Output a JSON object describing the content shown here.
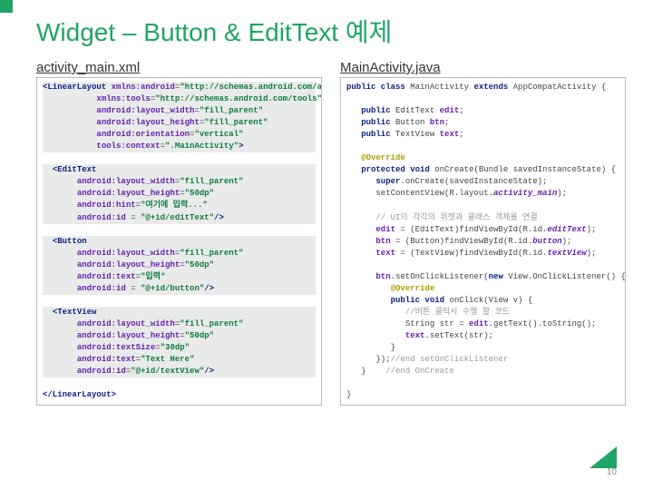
{
  "title": "Widget – Button & EditText 예제",
  "left_filename": "activity_main.xml",
  "right_filename": "MainActivity.java",
  "page_number": "10",
  "xml": {
    "root_open_tag": "<LinearLayout",
    "ns_android_attr": "xmlns:android",
    "ns_android_val": "\"http://schemas.android.com/apk/res/android\"",
    "ns_tools_attr": "xmlns:tools",
    "ns_tools_val": "\"http://schemas.android.com/tools\"",
    "lw_attr": "android:layout_width",
    "lh_attr": "android:layout_height",
    "or_attr": "android:orientation",
    "ctx_attr": "tools:context",
    "hint_attr": "android:hint",
    "id_attr": "android:id",
    "text_attr": "android:text",
    "ts_attr": "android:textSize",
    "fill_parent": "\"fill_parent\"",
    "h50": "\"50dp\"",
    "vertical": "\"vertical\"",
    "ctx": "\".MainActivity\"",
    "hint": "\"여기에 입력...\"",
    "id_edit": "\"@+id/editText\"",
    "txt_input": "\"입력\"",
    "id_btn": "\"@+id/button\"",
    "ts30": "\"30dp\"",
    "txt_here": "\"Text Here\"",
    "id_tv": "\"@+id/textView\"",
    "edittext_open": "<EditText",
    "button_open": "<Button",
    "textview_open": "<TextView",
    "close_self": "/>",
    "root_close": "</LinearLayout>",
    "gt": ">"
  },
  "java": {
    "l1a": "public class",
    "l1b": "MainActivity",
    "l1c": "extends",
    "l1d": "AppCompatActivity {",
    "l2a": "public",
    "l2b": "EditText",
    "l2c": "edit",
    "l3a": "public",
    "l3b": "Button",
    "l3c": "btn",
    "l4a": "public",
    "l4b": "TextView",
    "l4c": "text",
    "ov": "@Override",
    "l5a": "protected void",
    "l5b": "onCreate(Bundle savedInstanceState) {",
    "l6a": "super",
    "l6b": ".onCreate(savedInstanceState);",
    "l7a": "setContentView(R.layout.",
    "l7b": "activity_main",
    "l7c": ");",
    "c1": "// UI의 각각의 위젯과 클래스 객체를 연결",
    "l8a": "edit",
    "l8b": " = (EditText)findViewById(R.id.",
    "l8c": "editText",
    "l8d": ");",
    "l9a": "btn",
    "l9b": " = (Button)findViewById(R.id.",
    "l9c": "button",
    "l9d": ");",
    "l10a": "text",
    "l10b": " = (TextView)findViewById(R.id.",
    "l10c": "textView",
    "l10d": ");",
    "l11a": "btn",
    "l11b": ".setOnClickListener(",
    "l11c": "new",
    "l11d": " View.OnClickListener() {",
    "l12a": "public void",
    "l12b": "onClick(View v) {",
    "c2": "//버튼 클릭시 수행 할 코드",
    "l13a": "String str = ",
    "l13b": "edit",
    "l13c": ".getText().toString();",
    "l14a": "text",
    "l14b": ".setText(str);",
    "rb": "}",
    "l15a": "});",
    "l15b": "//end setOnClickListener",
    "c3": "//end OnCreate"
  }
}
